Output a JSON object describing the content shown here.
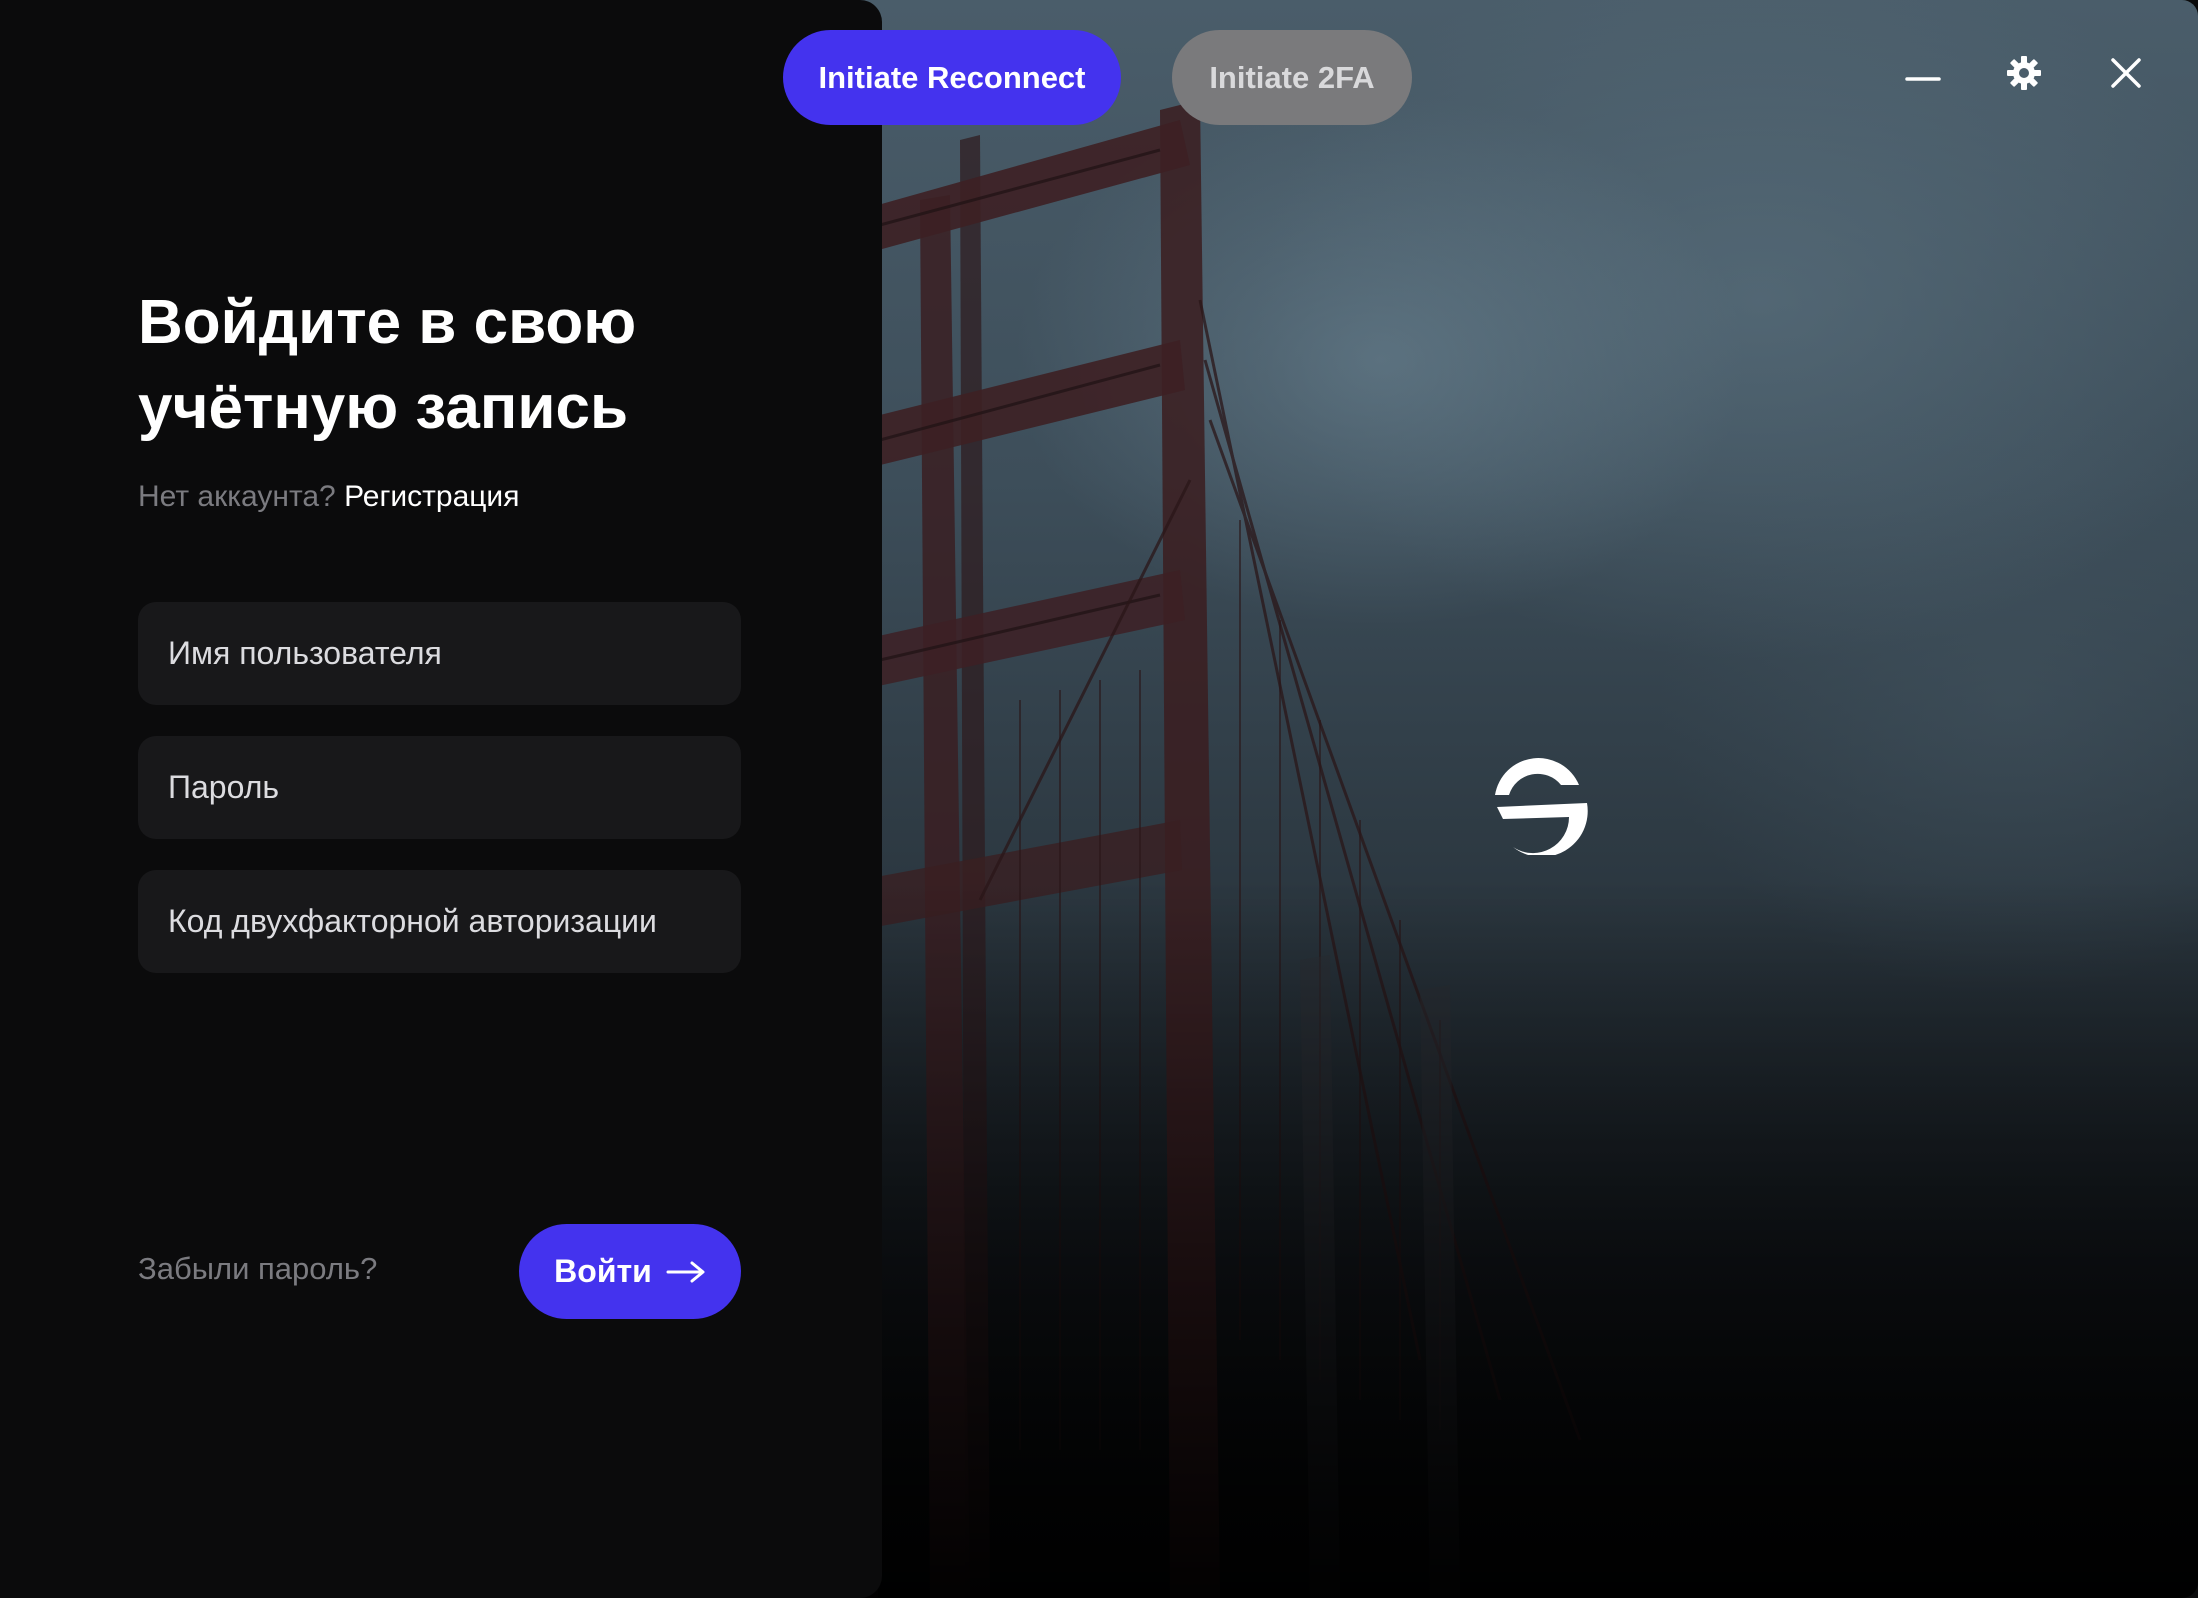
{
  "header": {
    "reconnect_label": "Initiate Reconnect",
    "twofa_label": "Initiate 2FA",
    "controls": {
      "minimize_icon": "minimize-icon",
      "settings_icon": "gear-icon",
      "close_icon": "close-icon"
    }
  },
  "login": {
    "title_line1": "Войдите в свою",
    "title_line2": "учётную запись",
    "no_account_text": "Нет аккаунта?",
    "register_link": "Регистрация",
    "username_placeholder": "Имя пользователя",
    "password_placeholder": "Пароль",
    "twofa_placeholder": "Код двухфакторной авторизации",
    "forgot_password": "Забыли пароль?",
    "submit_label": "Войти",
    "submit_icon": "arrow-right-icon"
  },
  "brand": {
    "logo_icon": "brand-logo-icon"
  },
  "colors": {
    "accent": "#4433ee",
    "panel_bg": "#0b0b0c",
    "field_bg": "#18181a",
    "muted_text": "#7b7b80",
    "disabled_pill": "#7a7a7c"
  }
}
